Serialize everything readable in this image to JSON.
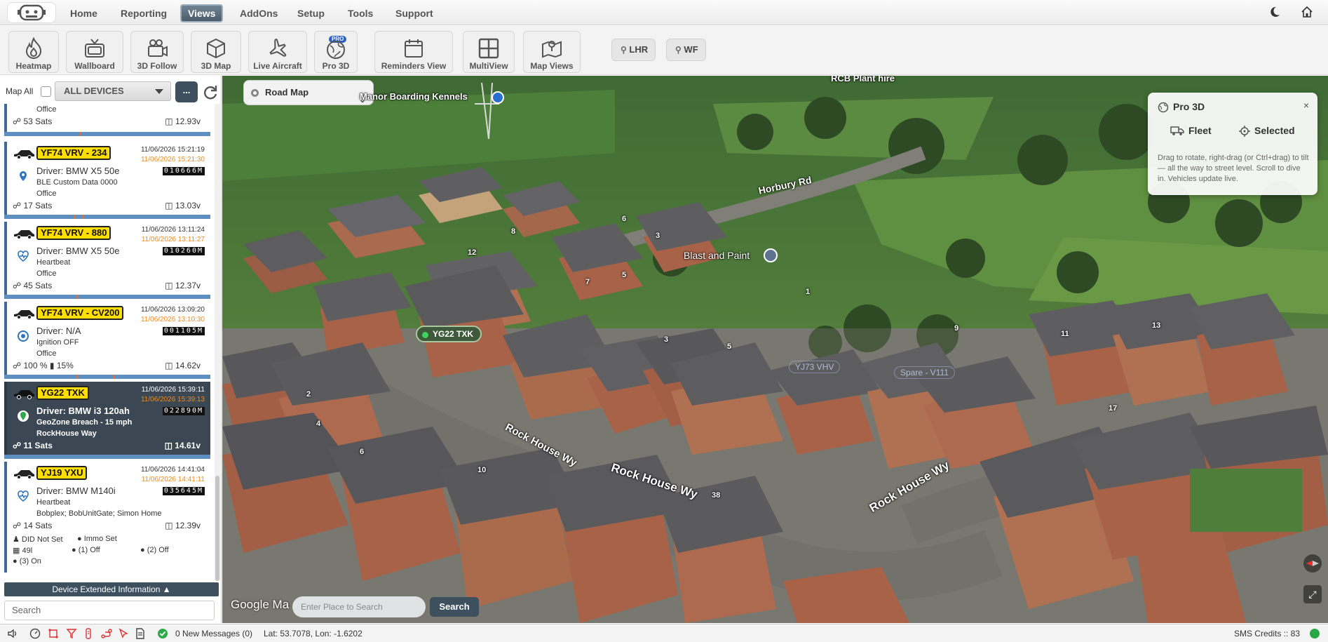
{
  "nav": {
    "items": [
      "Home",
      "Reporting",
      "Views",
      "AddOns",
      "Setup",
      "Tools",
      "Support"
    ],
    "active": "Views",
    "right_icons": [
      "moon-icon",
      "home-icon"
    ]
  },
  "toolbar": {
    "buttons": [
      {
        "label": "Heatmap",
        "icon": "heatmap-icon"
      },
      {
        "label": "Wallboard",
        "icon": "tv-icon"
      },
      {
        "label": "3D Follow",
        "icon": "camera-icon"
      },
      {
        "label": "3D Map",
        "icon": "cube-icon"
      },
      {
        "label": "Live Aircraft",
        "icon": "plane-icon"
      },
      {
        "label": "Pro 3D",
        "icon": "globe-icon",
        "badge": "PRO"
      },
      {
        "label": "Reminders View",
        "icon": "calendar-icon"
      },
      {
        "label": "MultiView",
        "icon": "grid-icon"
      },
      {
        "label": "Map Views",
        "icon": "map-icon"
      }
    ],
    "locations": [
      "LHR",
      "WF"
    ]
  },
  "left": {
    "map_all_label": "Map All",
    "device_select": "ALL DEVICES",
    "more_label": "...",
    "top_card": {
      "line4": "Office",
      "sats": "53 Sats",
      "volts": "12.93v"
    },
    "cards": [
      {
        "plate": "YF74 VRV - 234",
        "t1": "11/06/2026 15:21:19",
        "t2": "11/06/2026 15:21:30",
        "odo": "010666M",
        "driver": "Driver: BMW X5 50e",
        "line3": "BLE Custom Data 0000",
        "line4": "Office",
        "sats": "17 Sats",
        "volts": "13.03v",
        "status_icon": "location-pin-icon"
      },
      {
        "plate": "YF74 VRV - 880",
        "t1": "11/06/2026 13:11:24",
        "t2": "11/06/2026 13:11:27",
        "odo": "010260M",
        "driver": "Driver: BMW X5 50e",
        "line3": "Heartbeat",
        "line4": "Office",
        "sats": "45 Sats",
        "volts": "12.37v",
        "status_icon": "heartbeat-icon"
      },
      {
        "plate": "YF74 VRV - CV200",
        "t1": "11/06/2026 13:09:20",
        "t2": "11/06/2026 13:10:30",
        "odo": "001105M",
        "driver": "Driver: N/A",
        "line3": "Ignition OFF",
        "line4": "Office",
        "sats": "100 %",
        "battery": "15%",
        "volts": "14.62v",
        "status_icon": "ignition-off-icon"
      },
      {
        "plate": "YG22 TXK",
        "t1": "11/06/2026 15:39:11",
        "t2": "11/06/2026 15:39:13",
        "odo": "022890M",
        "driver": "Driver: BMW i3 120ah",
        "line3": "GeoZone Breach - 15 mph",
        "line4": "RockHouse Way",
        "sats": "11 Sats",
        "volts": "14.61v",
        "status_icon": "geozone-icon",
        "selected": true
      },
      {
        "plate": "YJ19 YXU",
        "t1": "11/06/2026 14:41:04",
        "t2": "11/06/2026 14:41:11",
        "odo": "035645M",
        "driver": "Driver: BMW M140i",
        "line3": "Heartbeat",
        "line4": "Bobplex; BobUnitGate; Simon Home",
        "sats": "14 Sats",
        "volts": "12.39v",
        "status_icon": "heartbeat-icon",
        "extra": {
          "did": "DID Not Set",
          "immo": "Immo Set",
          "fuel": "49l",
          "in1": "(1) Off",
          "in2": "(2) Off",
          "in3": "(3) On"
        }
      }
    ],
    "ext_info_label": "Device Extended Information",
    "search_placeholder": "Search"
  },
  "map": {
    "map_type": "Road Map",
    "labels": {
      "kennels": "Manor Boarding Kennels",
      "plant": "RCB Plant hire",
      "horbury": "Horbury Rd",
      "blast": "Blast and Paint",
      "rock1": "Rock House Wy",
      "rock2": "Rock House Wy",
      "rock3": "Rock House Wy"
    },
    "house_numbers": [
      "8",
      "6",
      "3",
      "12",
      "7",
      "5",
      "1",
      "9",
      "11",
      "13",
      "3",
      "5",
      "2",
      "4",
      "6",
      "10",
      "38",
      "17"
    ],
    "vehicle_tag": "YG22 TXK",
    "ghost_tags": [
      "YJ73 VHV",
      "Spare - V111"
    ],
    "pro3d": {
      "title": "Pro 3D",
      "close": "×",
      "fleet": "Fleet",
      "selected": "Selected",
      "desc": "Drag to rotate, right-drag (or Ctrl+drag) to tilt — all the way to street level. Scroll to dive in. Vehicles update live."
    },
    "place_placeholder": "Enter Place to Search",
    "search_btn": "Search",
    "google": "Google Ma"
  },
  "status": {
    "messages": "0 New Messages (0)",
    "latlon": "Lat: 53.7078, Lon: -1.6202",
    "sms": "SMS Credits :: 83"
  },
  "colors": {
    "plate_yellow": "#ffde00",
    "selected_card": "#3b4753",
    "accent_dark": "#3e4f5e",
    "timestamp_orange": "#f08b1c",
    "status_green": "#28a745"
  }
}
